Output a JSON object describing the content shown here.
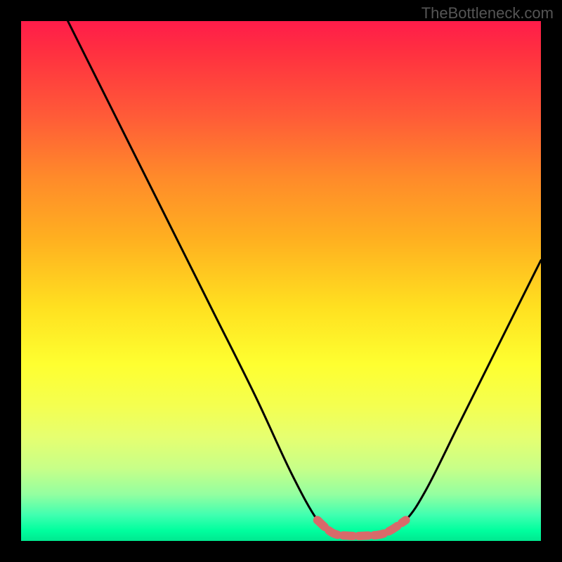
{
  "watermark": "TheBottleneck.com",
  "chart_data": {
    "type": "line",
    "title": "",
    "xlabel": "",
    "ylabel": "",
    "xlim": [
      0,
      100
    ],
    "ylim": [
      0,
      100
    ],
    "grid": false,
    "series": [
      {
        "name": "main-curve",
        "color": "#000000",
        "x": [
          9,
          15,
          22,
          30,
          37,
          45,
          52,
          57,
          60,
          63,
          66,
          70,
          74,
          78,
          84,
          90,
          96,
          100
        ],
        "y": [
          100,
          88,
          74,
          58,
          44,
          28,
          13,
          4,
          1.5,
          1,
          1,
          1.5,
          4,
          10,
          22,
          34,
          46,
          54
        ]
      }
    ],
    "highlights": [
      {
        "name": "bottom-segment",
        "color": "#e07070",
        "x": [
          57,
          60,
          63,
          66,
          70,
          74
        ],
        "y": [
          4,
          1.5,
          1,
          1,
          1.5,
          4
        ]
      }
    ]
  }
}
